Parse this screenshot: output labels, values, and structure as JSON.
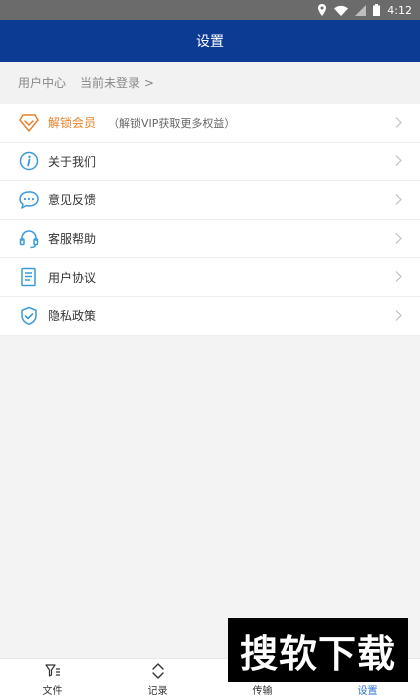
{
  "status_bar": {
    "time": "4:12"
  },
  "header": {
    "title": "设置"
  },
  "user_center": {
    "label": "用户中心",
    "login_status": "当前未登录 >"
  },
  "menu": {
    "items": [
      {
        "icon": "diamond-icon",
        "label": "解锁会员",
        "sub": "（解锁VIP获取更多权益）"
      },
      {
        "icon": "info-icon",
        "label": "关于我们"
      },
      {
        "icon": "chat-icon",
        "label": "意见反馈"
      },
      {
        "icon": "headset-icon",
        "label": "客服帮助"
      },
      {
        "icon": "document-icon",
        "label": "用户协议"
      },
      {
        "icon": "shield-check-icon",
        "label": "隐私政策"
      }
    ]
  },
  "bottom_nav": {
    "items": [
      {
        "icon": "filter-icon",
        "label": "文件"
      },
      {
        "icon": "sort-arrows-icon",
        "label": "记录"
      },
      {
        "icon": "transfer-icon",
        "label": "传输"
      },
      {
        "icon": "settings-icon",
        "label": "设置",
        "active": true
      }
    ]
  },
  "watermark": {
    "text": "搜软下载"
  },
  "colors": {
    "appbar": "#0c3b94",
    "vip": "#e8822a",
    "icon": "#3a9bd8",
    "active_tab": "#2b6fd6"
  }
}
